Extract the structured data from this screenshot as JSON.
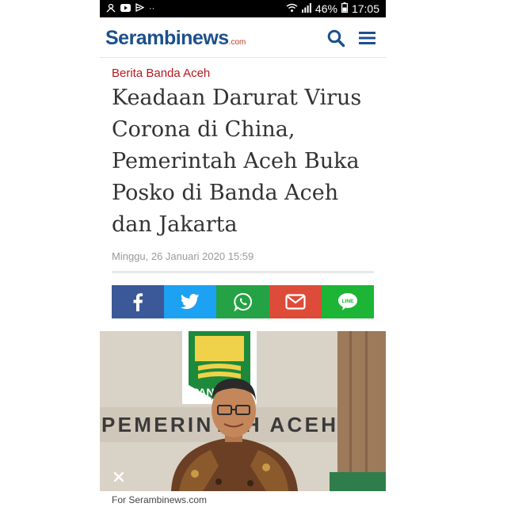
{
  "status_bar": {
    "battery": "46%",
    "time": "17:05",
    "left_icons": [
      "person-icon",
      "youtube-icon",
      "play-icon"
    ],
    "dots": "··"
  },
  "header": {
    "logo": "Serambinews",
    "logo_suffix": ".com",
    "brand_color": "#1b4f8c",
    "icons": [
      "search-icon",
      "menu-icon"
    ]
  },
  "article": {
    "category": "Berita Banda Aceh",
    "title": "Keadaan Darurat Virus Corona di China, Pemerintah Aceh Buka Posko di Banda Aceh dan Jakarta",
    "date": "Minggu, 26 Januari 2020 15:59"
  },
  "share": {
    "buttons": [
      {
        "name": "facebook",
        "color": "#3b5998"
      },
      {
        "name": "twitter",
        "color": "#1da1f2"
      },
      {
        "name": "whatsapp",
        "color": "#25a245"
      },
      {
        "name": "email",
        "color": "#dd4b39"
      },
      {
        "name": "line",
        "color": "#1cb536"
      }
    ],
    "line_label": "LINE"
  },
  "photo": {
    "banner_text": "PEMERINTAH ACEH",
    "party_text": "PAN",
    "caption": "For Serambinews.com"
  }
}
